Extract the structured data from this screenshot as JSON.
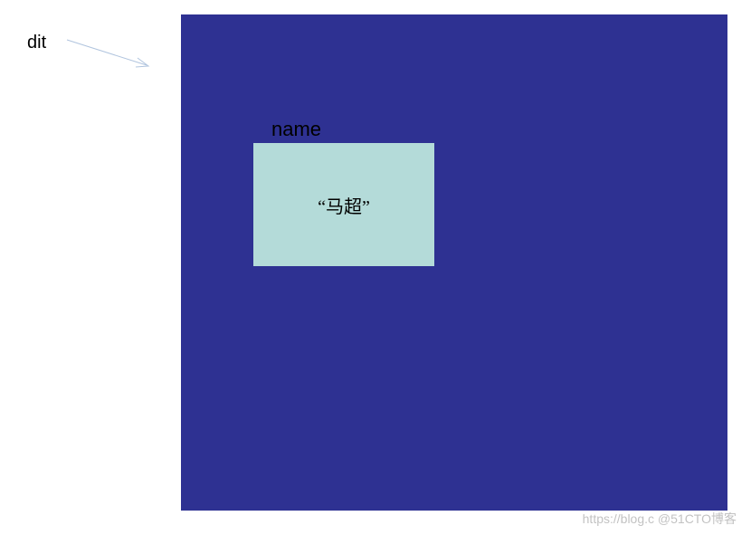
{
  "outer": {
    "label": "dit"
  },
  "inner": {
    "label": "name",
    "value": "“马超”"
  },
  "colors": {
    "big_box_bg": "#2e3192",
    "small_box_bg": "#b4dbd9",
    "arrow_stroke": "#b0c4de"
  },
  "watermark": "https://blog.c  @51CTO博客"
}
